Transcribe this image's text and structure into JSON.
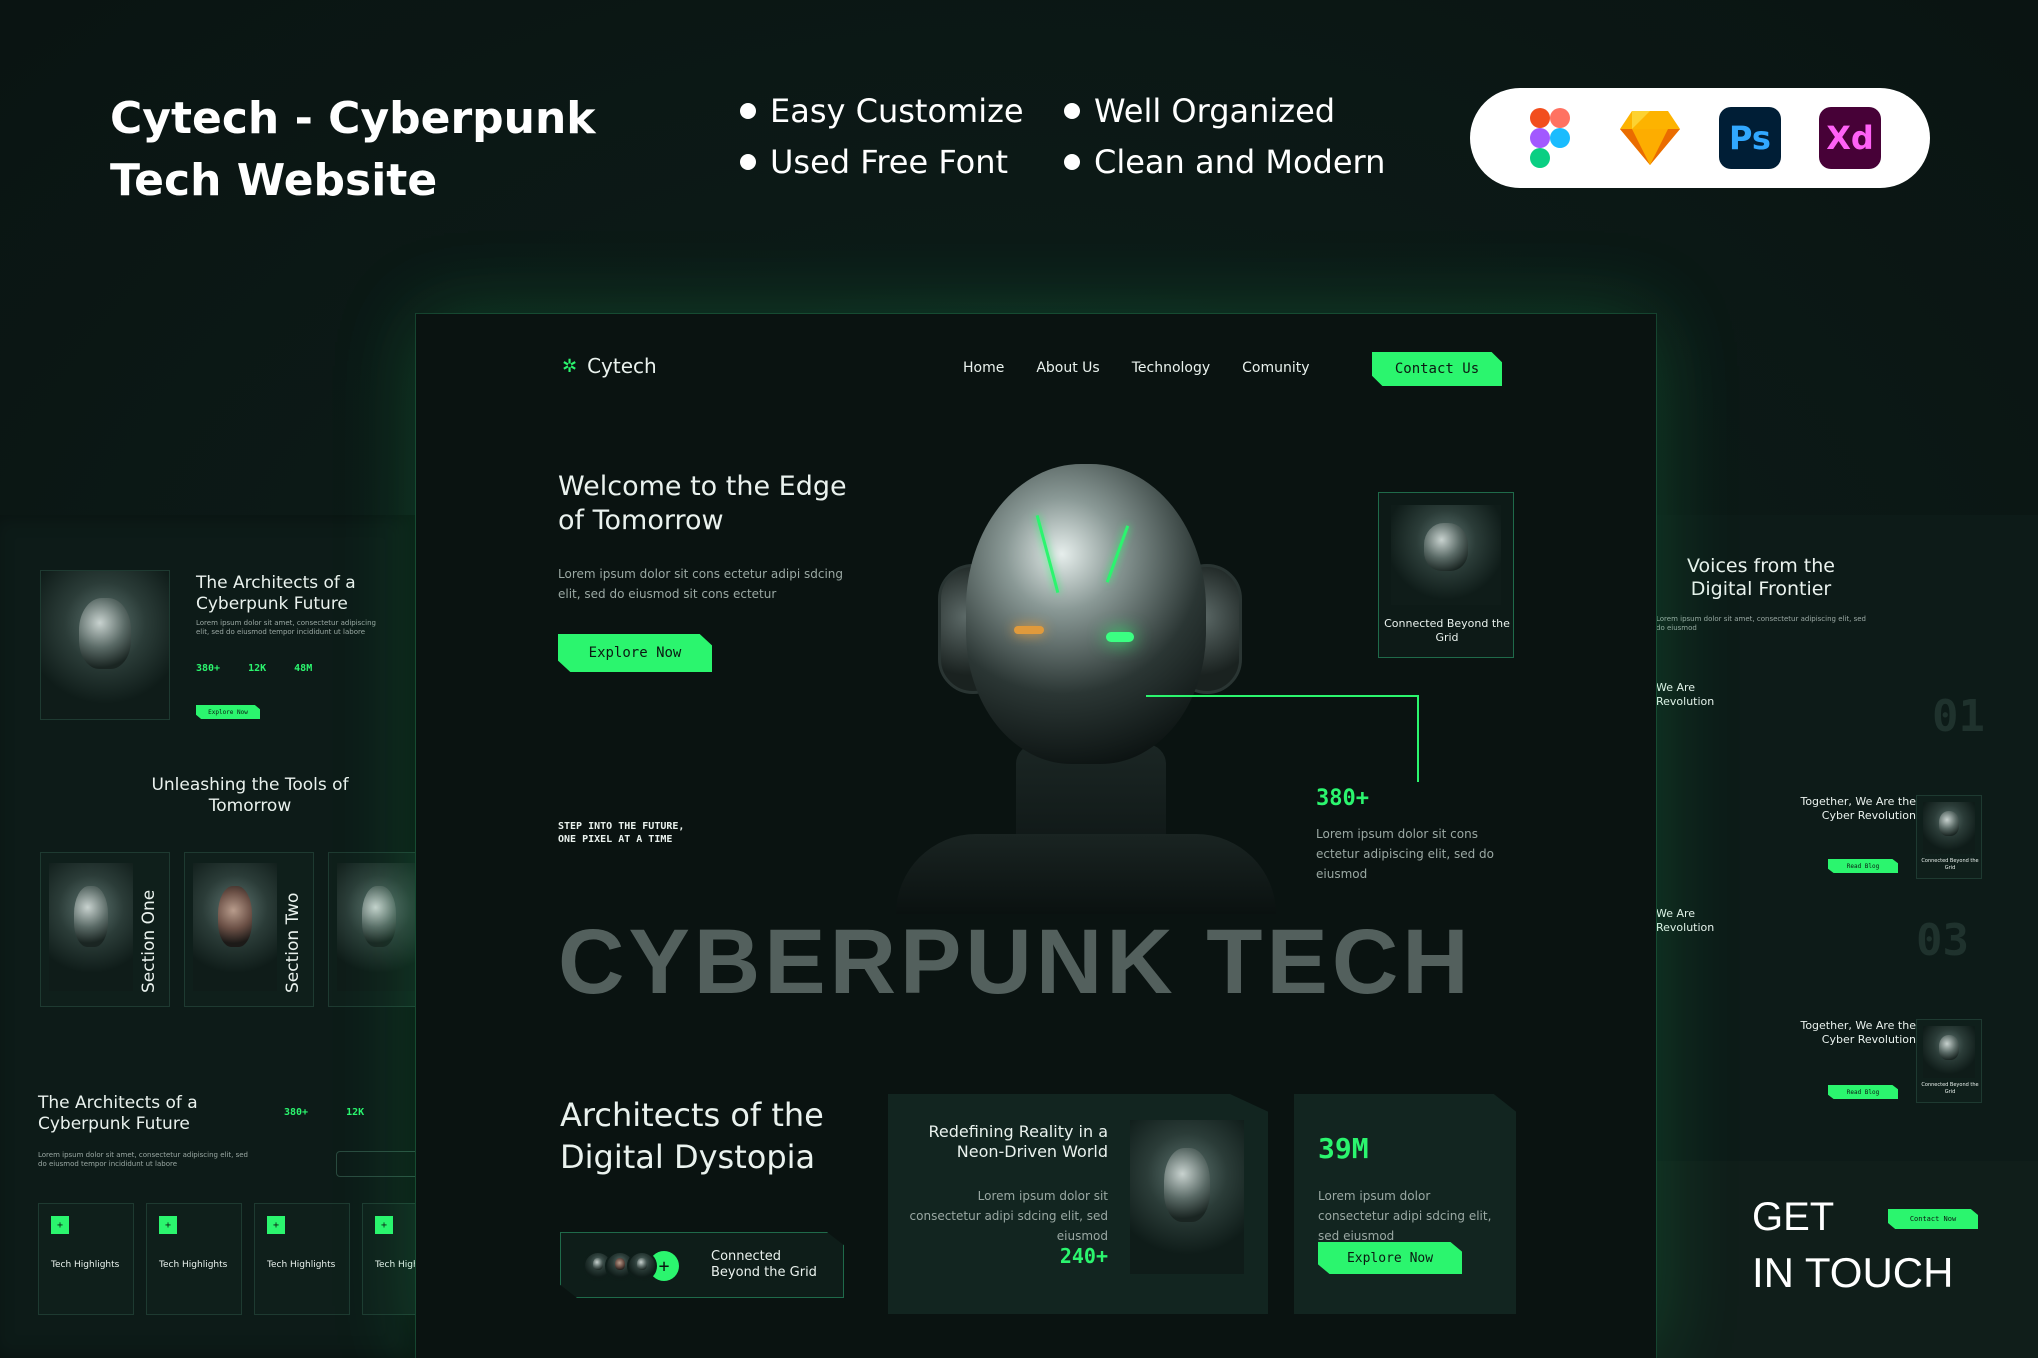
{
  "header": {
    "title": "Cytech - Cyberpunk Tech Website",
    "features": [
      "Easy Customize",
      "Used Free Font",
      "Well Organized",
      "Clean and Modern"
    ],
    "tools": [
      {
        "name": "figma-icon",
        "label": ""
      },
      {
        "name": "sketch-icon",
        "label": ""
      },
      {
        "name": "photoshop-icon",
        "label": "Ps"
      },
      {
        "name": "xd-icon",
        "label": "Xd"
      }
    ]
  },
  "main": {
    "logo": "Cytech",
    "nav": [
      "Home",
      "About Us",
      "Technology",
      "Comunity"
    ],
    "contact_label": "Contact Us",
    "hero": {
      "title": "Welcome to the Edge of Tomorrow",
      "text": "Lorem ipsum dolor sit cons ectetur adipi sdcing elit, sed do eiusmod  sit cons ectetur",
      "cta": "Explore Now",
      "side_card": "Connected Beyond the Grid",
      "tagline": "STEP INTO THE FUTURE, ONE PIXEL AT A TIME",
      "stat_value": "380+",
      "stat_text": "Lorem ipsum dolor sit cons ectetur adipiscing elit, sed do eiusmod",
      "big_text": "CYBERPUNK TECH"
    },
    "about": {
      "title": "Architects of the Digital Dystopia",
      "badge": "Connected Beyond the Grid",
      "card1_title": "Redefining Reality in a Neon-Driven World",
      "card1_text": "Lorem ipsum dolor sit consectetur adipi sdcing elit, sed eiusmod",
      "card1_value": "240+",
      "card2_value": "39M",
      "card2_text": "Lorem ipsum dolor consectetur adipi sdcing elit, sed eiusmod",
      "card2_cta": "Explore Now"
    }
  },
  "left": {
    "arch_title": "The Architects of a Cyberpunk Future",
    "stats": [
      "380+",
      "12K",
      "48M"
    ],
    "explore": "Explore Now",
    "tools_title": "Unleashing the Tools of Tomorrow",
    "sections": [
      "Section One",
      "Section Two"
    ],
    "arch2_title": "The Architects of a Cyberpunk Future",
    "stats2": [
      "380+",
      "12K"
    ],
    "highlights": [
      "Tech Highlights",
      "Tech Highlights",
      "Tech Highlights",
      "Tech High"
    ]
  },
  "right": {
    "voices_title": "Voices from the Digital Frontier",
    "rev1": "We Are Revolution",
    "num1": "01",
    "together1": "Together, We Are the Cyber Revolution",
    "read": "Read Blog",
    "rev2": "We Are Revolution",
    "num2": "03",
    "together2": "Together, We Are the Cyber Revolution",
    "connected": "Connected Beyond the Grid",
    "get": "GET",
    "in_touch": "IN TOUCH",
    "contact": "Contact Now"
  }
}
